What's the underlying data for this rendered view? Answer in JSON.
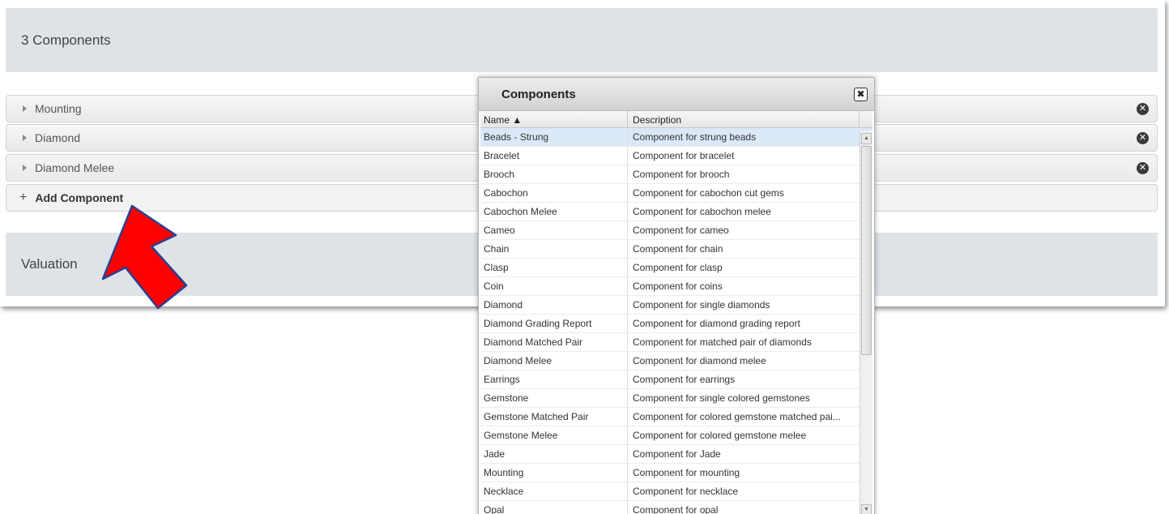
{
  "sections": {
    "components_header": "3 Components",
    "valuation_header": "Valuation"
  },
  "component_rows": [
    {
      "label": "Mounting"
    },
    {
      "label": "Diamond"
    },
    {
      "label": "Diamond Melee"
    }
  ],
  "add_component": {
    "plus": "+",
    "label": "Add Component"
  },
  "dialog": {
    "title": "Components",
    "close_glyph": "✖",
    "columns": {
      "name": "Name ▲",
      "description": "Description"
    },
    "rows": [
      {
        "name": "Beads - Strung",
        "description": "Component for strung beads",
        "selected": true
      },
      {
        "name": "Bracelet",
        "description": "Component for bracelet"
      },
      {
        "name": "Brooch",
        "description": "Component for brooch"
      },
      {
        "name": "Cabochon",
        "description": "Component for cabochon cut gems"
      },
      {
        "name": "Cabochon Melee",
        "description": "Component for cabochon melee"
      },
      {
        "name": "Cameo",
        "description": "Component for cameo"
      },
      {
        "name": "Chain",
        "description": "Component for chain"
      },
      {
        "name": "Clasp",
        "description": "Component for clasp"
      },
      {
        "name": "Coin",
        "description": "Component for coins"
      },
      {
        "name": "Diamond",
        "description": "Component for single diamonds"
      },
      {
        "name": "Diamond Grading Report",
        "description": "Component for diamond grading report"
      },
      {
        "name": "Diamond Matched Pair",
        "description": "Component for matched pair of diamonds"
      },
      {
        "name": "Diamond Melee",
        "description": "Component for diamond melee"
      },
      {
        "name": "Earrings",
        "description": "Component for earrings"
      },
      {
        "name": "Gemstone",
        "description": "Component for single colored gemstones"
      },
      {
        "name": "Gemstone Matched Pair",
        "description": "Component for colored gemstone matched pai..."
      },
      {
        "name": "Gemstone Melee",
        "description": "Component for colored gemstone melee"
      },
      {
        "name": "Jade",
        "description": "Component for Jade"
      },
      {
        "name": "Mounting",
        "description": "Component for mounting"
      },
      {
        "name": "Necklace",
        "description": "Component for necklace"
      },
      {
        "name": "Opal",
        "description": "Component for opal"
      }
    ]
  },
  "colors": {
    "arrow": "#ff0000",
    "arrow_outline": "#2a3f8f",
    "header_bg": "#dde3e6",
    "selected_row": "#dbe8f8"
  },
  "icons": {
    "remove": "remove-circle-icon",
    "expand": "triangle-right-icon",
    "close": "close-icon",
    "scroll_up": "▲",
    "scroll_down": "▼"
  }
}
